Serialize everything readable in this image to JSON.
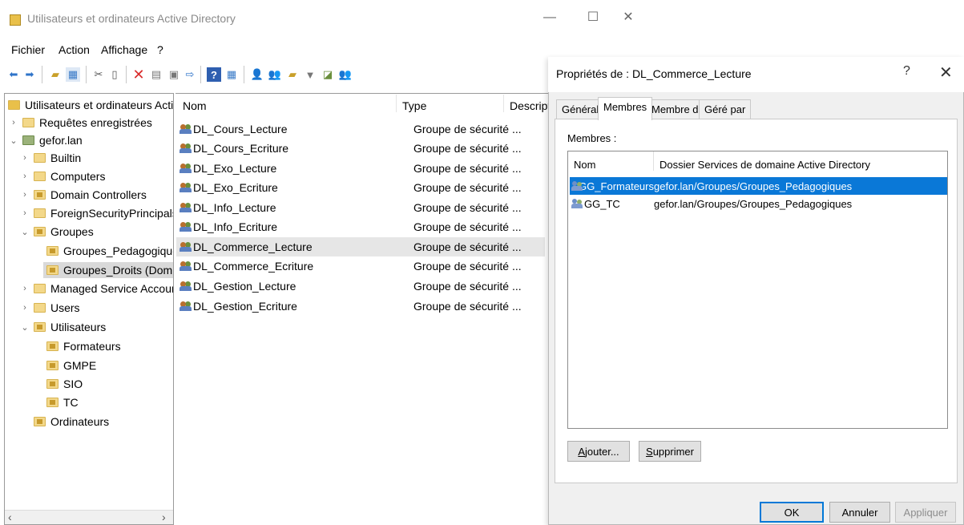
{
  "main": {
    "title": "Utilisateurs et ordinateurs Active Directory",
    "window_controls": {
      "minimize": "—",
      "maximize": "☐",
      "close": "✕"
    },
    "menu": [
      "Fichier",
      "Action",
      "Affichage",
      "?"
    ],
    "tree": {
      "root": "Utilisateurs et ordinateurs Active",
      "items": [
        {
          "label": "Requêtes enregistrées"
        },
        {
          "label": "gefor.lan"
        },
        {
          "label": "Builtin"
        },
        {
          "label": "Computers"
        },
        {
          "label": "Domain Controllers"
        },
        {
          "label": "ForeignSecurityPrincipals"
        },
        {
          "label": "Groupes"
        },
        {
          "label": "Groupes_Pedagogiques"
        },
        {
          "label": "Groupes_Droits (Dom"
        },
        {
          "label": "Managed Service Accour"
        },
        {
          "label": "Users"
        },
        {
          "label": "Utilisateurs"
        },
        {
          "label": "Formateurs"
        },
        {
          "label": "GMPE"
        },
        {
          "label": "SIO"
        },
        {
          "label": "TC"
        },
        {
          "label": "Ordinateurs"
        }
      ]
    },
    "list": {
      "columns": [
        "Nom",
        "Type",
        "Descripti"
      ],
      "rows": [
        {
          "name": "DL_Cours_Lecture",
          "type": "Groupe de sécurité ..."
        },
        {
          "name": "DL_Cours_Ecriture",
          "type": "Groupe de sécurité ..."
        },
        {
          "name": "DL_Exo_Lecture",
          "type": "Groupe de sécurité ..."
        },
        {
          "name": "DL_Exo_Ecriture",
          "type": "Groupe de sécurité ..."
        },
        {
          "name": "DL_Info_Lecture",
          "type": "Groupe de sécurité ..."
        },
        {
          "name": "DL_Info_Ecriture",
          "type": "Groupe de sécurité ..."
        },
        {
          "name": "DL_Commerce_Lecture",
          "type": "Groupe de sécurité ..."
        },
        {
          "name": "DL_Commerce_Ecriture",
          "type": "Groupe de sécurité ..."
        },
        {
          "name": "DL_Gestion_Lecture",
          "type": "Groupe de sécurité ..."
        },
        {
          "name": "DL_Gestion_Ecriture",
          "type": "Groupe de sécurité ..."
        }
      ]
    }
  },
  "dialog": {
    "title": "Propriétés de : DL_Commerce_Lecture",
    "help": "?",
    "close": "✕",
    "tabs": [
      "Général",
      "Membres",
      "Membre de",
      "Géré par"
    ],
    "active_tab": "Membres",
    "members_label": "Membres :",
    "columns": [
      "Nom",
      "Dossier Services de domaine Active Directory"
    ],
    "members": [
      {
        "name": "GG_Formateurs",
        "folder": "gefor.lan/Groupes/Groupes_Pedagogiques"
      },
      {
        "name": "GG_TC",
        "folder": "gefor.lan/Groupes/Groupes_Pedagogiques"
      }
    ],
    "buttons": {
      "add": "Ajouter...",
      "remove": "Supprimer",
      "ok": "OK",
      "cancel": "Annuler",
      "apply": "Appliquer"
    }
  },
  "colors": {
    "selection": "#0a78d7",
    "folder": "#f3d88a",
    "delete_icon": "#d92b2b"
  }
}
